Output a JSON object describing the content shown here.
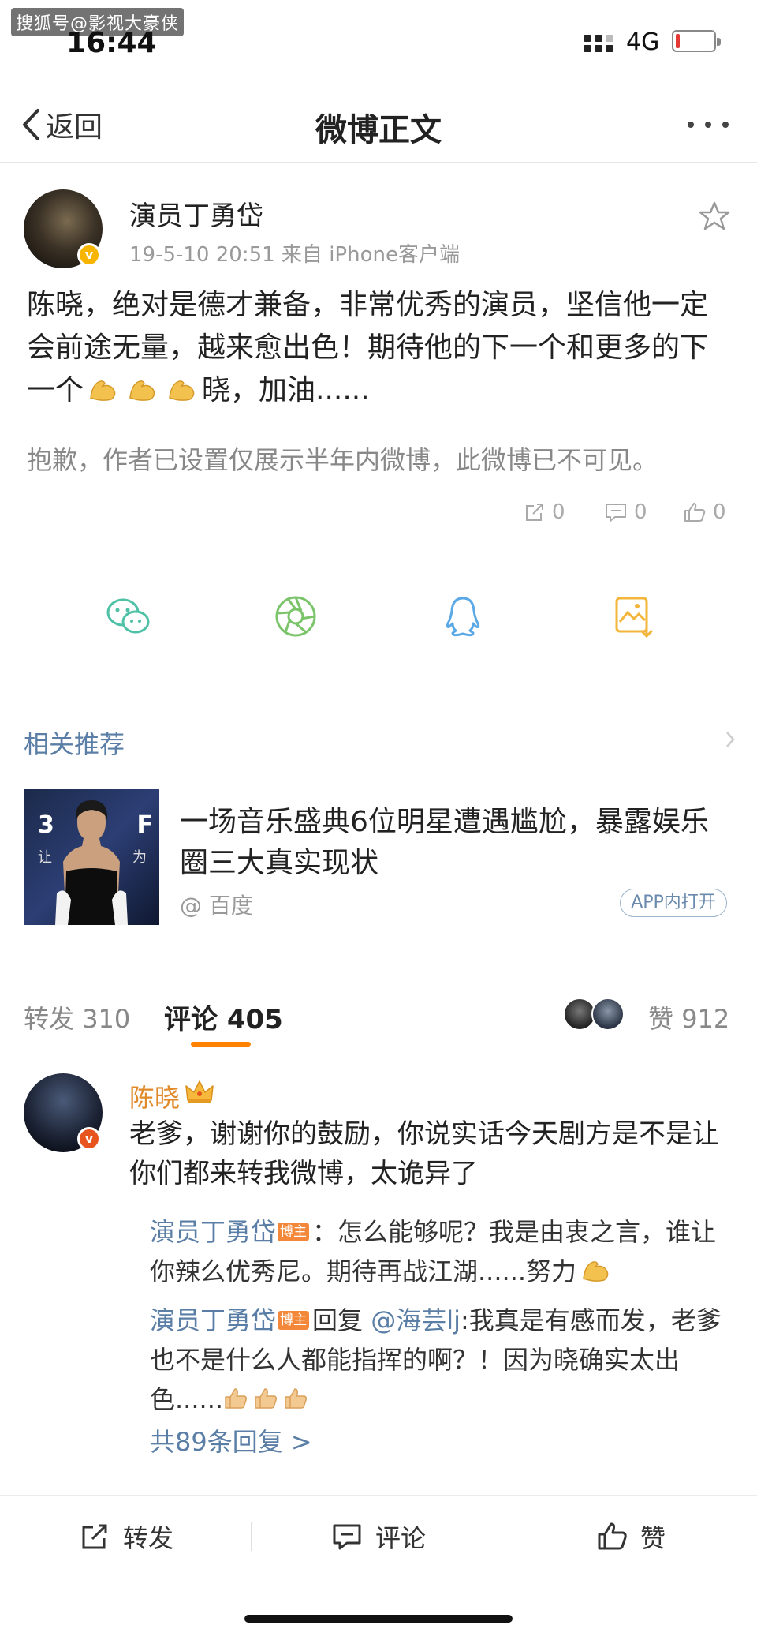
{
  "status_bar": {
    "watermark": "搜狐号@影视大豪侠",
    "time": "16:44",
    "network": "4G"
  },
  "nav": {
    "back_label": "返回",
    "title": "微博正文"
  },
  "post": {
    "author": "演员丁勇岱",
    "meta": "19-5-10 20:51  来自 iPhone客户端",
    "text_part1": "陈晓，绝对是德才兼备，非常优秀的演员，坚信他一定会前途无量，越来愈出色！期待他的下一个和更多的下一个",
    "text_part2": "晓，加油......",
    "hidden_note": "抱歉，作者已设置仅展示半年内微博，此微博已不可见。",
    "repost_count": "0",
    "comment_count": "0",
    "like_count": "0"
  },
  "related": {
    "section_title": "相关推荐",
    "thumb_text_1": "3",
    "thumb_text_2": "F",
    "thumb_text_3": "让",
    "thumb_text_4": "为",
    "headline": "一场音乐盛典6位明星遭遇尴尬，暴露娱乐圈三大真实现状",
    "source": "@ 百度",
    "open_label": "APP内打开"
  },
  "tabs": {
    "repost_label": "转发",
    "repost_count": "310",
    "comment_label": "评论",
    "comment_count": "405",
    "like_label": "赞",
    "like_count": "912"
  },
  "comment": {
    "author": "陈晓",
    "text": "老爹，谢谢你的鼓励，你说实话今天剧方是不是让你们都来转我微博，太诡异了",
    "replies": [
      {
        "name": "演员丁勇岱",
        "tag": "博主",
        "text": "：怎么能够呢？我是由衷之言，谁让你辣么优秀尼。期待再战江湖......努力"
      },
      {
        "name": "演员丁勇岱",
        "tag": "博主",
        "reply_word": "回复",
        "mention": "@海芸lj",
        "text": ":我真是有感而发，老爹也不是什么人都能指挥的啊？！因为晓确实太出色......"
      }
    ],
    "more_replies": "共89条回复 >"
  },
  "bottom_bar": {
    "repost": "转发",
    "comment": "评论",
    "like": "赞"
  },
  "colors": {
    "accent_orange": "#ff8200",
    "link_blue": "#5a7ea5",
    "verified_gold": "#f7b500"
  }
}
